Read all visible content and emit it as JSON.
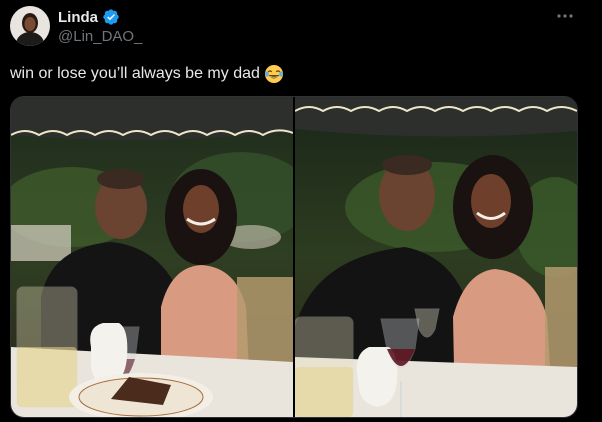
{
  "post": {
    "author": {
      "display_name": "Linda",
      "handle": "@Lin_DAO_",
      "verified": true,
      "avatar_icon": "profile-photo"
    },
    "text": "win or lose you’ll always be my dad",
    "emoji": "face-with-tears-of-joy",
    "more_icon": "more-dots-icon",
    "media": {
      "count": 2,
      "items": [
        {
          "name": "photo-1"
        },
        {
          "name": "photo-2"
        }
      ]
    }
  },
  "colors": {
    "background": "#000000",
    "text": "#e7e9ea",
    "secondary": "#71767b",
    "verified_badge": "#1d9bf0",
    "border": "#2f3336"
  }
}
